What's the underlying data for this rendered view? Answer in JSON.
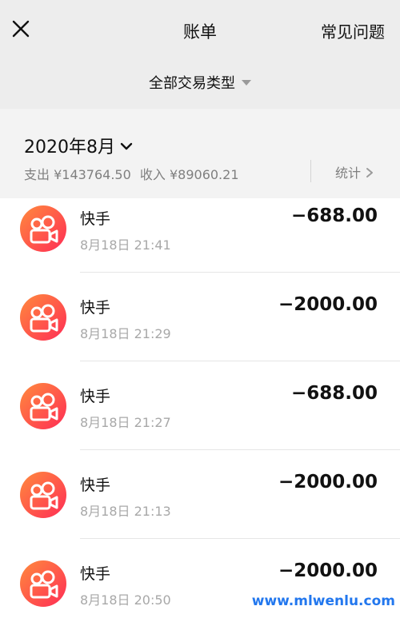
{
  "header": {
    "title": "账单",
    "faq_label": "常见问题",
    "close_icon": "close-icon"
  },
  "filter": {
    "label": "全部交易类型",
    "icon": "caret-down-icon"
  },
  "month": {
    "label": "2020年8月",
    "icon": "chevron-down-icon",
    "summary_expense": "支出 ¥143764.50",
    "summary_income": "收入 ¥89060.21",
    "stats_label": "统计",
    "stats_icon": "chevron-right-icon"
  },
  "colors": {
    "header_bg": "#ededed",
    "month_bg": "#f3f3f3",
    "icon_gradient_start": "#ff7a45",
    "icon_gradient_end": "#ff2d55",
    "watermark": "#2277ee"
  },
  "transactions": [
    {
      "name": "快手",
      "time": "8月18日 21:41",
      "amount": "−688.00",
      "icon": "kuaishou-app-icon"
    },
    {
      "name": "快手",
      "time": "8月18日 21:29",
      "amount": "−2000.00",
      "icon": "kuaishou-app-icon"
    },
    {
      "name": "快手",
      "time": "8月18日 21:27",
      "amount": "−688.00",
      "icon": "kuaishou-app-icon"
    },
    {
      "name": "快手",
      "time": "8月18日 21:13",
      "amount": "−2000.00",
      "icon": "kuaishou-app-icon"
    },
    {
      "name": "快手",
      "time": "8月18日 20:50",
      "amount": "−2000.00",
      "icon": "kuaishou-app-icon"
    }
  ],
  "watermark": "www.mlwenlu.com"
}
